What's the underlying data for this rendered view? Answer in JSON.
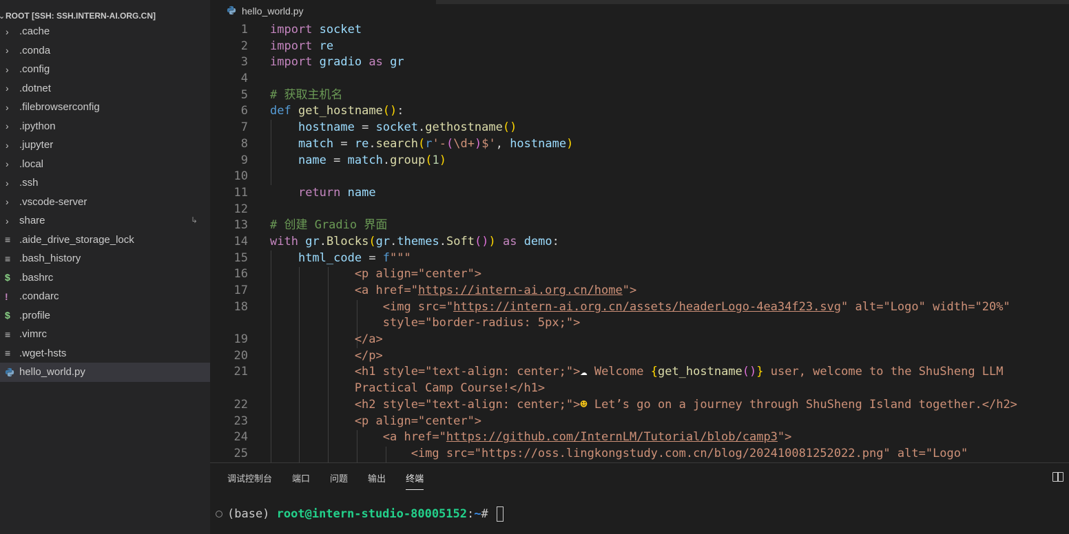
{
  "explorer": {
    "root_label": "ROOT [SSH: SSH.INTERN-AI.ORG.CN]",
    "items": [
      {
        "label": ".cache",
        "kind": "folder"
      },
      {
        "label": ".conda",
        "kind": "folder"
      },
      {
        "label": ".config",
        "kind": "folder"
      },
      {
        "label": ".dotnet",
        "kind": "folder"
      },
      {
        "label": ".filebrowserconfig",
        "kind": "folder"
      },
      {
        "label": ".ipython",
        "kind": "folder"
      },
      {
        "label": ".jupyter",
        "kind": "folder"
      },
      {
        "label": ".local",
        "kind": "folder"
      },
      {
        "label": ".ssh",
        "kind": "folder"
      },
      {
        "label": ".vscode-server",
        "kind": "folder"
      },
      {
        "label": "share",
        "kind": "folder-link"
      },
      {
        "label": ".aide_drive_storage_lock",
        "kind": "file-lines"
      },
      {
        "label": ".bash_history",
        "kind": "file-lines"
      },
      {
        "label": ".bashrc",
        "kind": "file-dollar"
      },
      {
        "label": ".condarc",
        "kind": "file-excl"
      },
      {
        "label": ".profile",
        "kind": "file-dollar"
      },
      {
        "label": ".vimrc",
        "kind": "file-lines"
      },
      {
        "label": ".wget-hsts",
        "kind": "file-lines"
      },
      {
        "label": "hello_world.py",
        "kind": "file-python",
        "selected": true
      }
    ]
  },
  "editor": {
    "tab_label": "hello_world.py",
    "line_numbers": [
      "1",
      "2",
      "3",
      "4",
      "5",
      "6",
      "7",
      "8",
      "9",
      "10",
      "11",
      "12",
      "13",
      "14",
      "15",
      "16",
      "17",
      "18",
      "",
      "19",
      "20",
      "21",
      "",
      "22",
      "23",
      "24",
      "25"
    ]
  },
  "panel": {
    "tabs": [
      "调试控制台",
      "端口",
      "问题",
      "输出",
      "终端"
    ],
    "active_tab": "终端",
    "terminal": {
      "env": "(base) ",
      "user_host": "root@intern-studio-80005152",
      "sep": ":",
      "path": "~",
      "prompt": "# "
    }
  },
  "colors": {
    "keyword": "#c586c0",
    "function": "#dcdcaa",
    "string": "#ce9178",
    "comment": "#6a9955",
    "terminal_user": "#23d18b"
  }
}
